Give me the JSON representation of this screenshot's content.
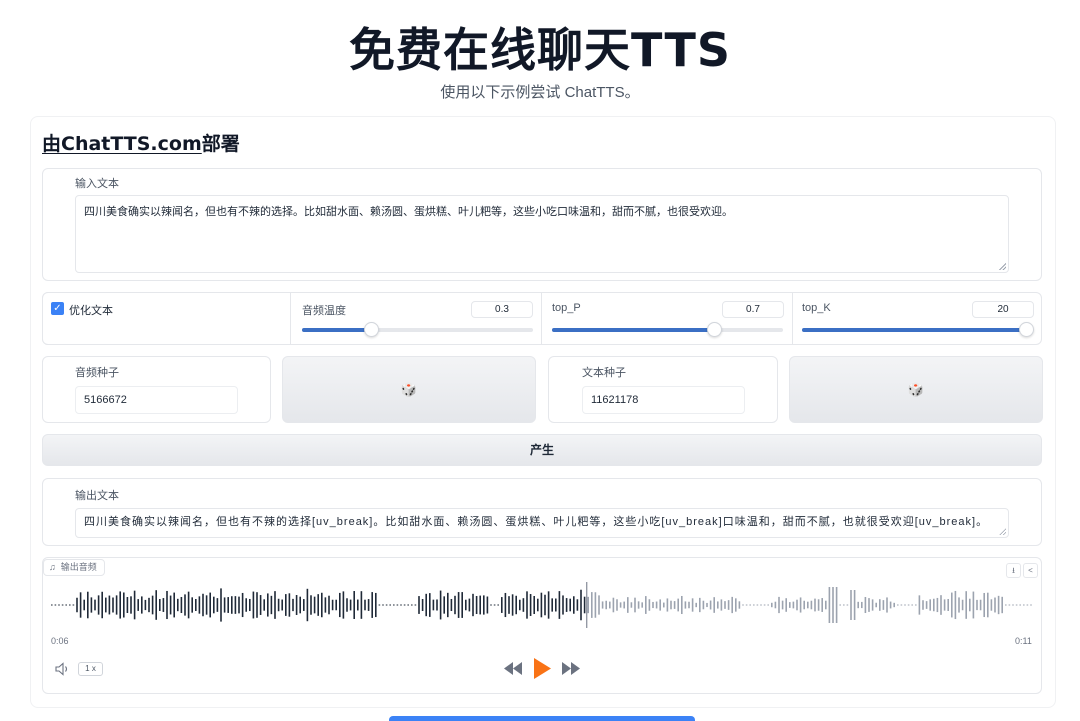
{
  "header": {
    "title": "免费在线聊天TTS",
    "subtitle": "使用以下示例尝试 ChatTTS。"
  },
  "deploy": {
    "link_text": "由ChatTTS.com",
    "suffix": "部署"
  },
  "input": {
    "label": "输入文本",
    "value": "四川美食确实以辣闻名，但也有不辣的选择。比如甜水面、赖汤圆、蛋烘糕、叶儿粑等，这些小吃口味温和，甜而不腻，也很受欢迎。"
  },
  "options": {
    "refine_label": "优化文本",
    "refine_checked": true,
    "sliders": [
      {
        "label": "音频温度",
        "value": "0.3",
        "fraction": 0.3
      },
      {
        "label": "top_P",
        "value": "0.7",
        "fraction": 0.7
      },
      {
        "label": "top_K",
        "value": "20",
        "fraction": 1.0
      }
    ]
  },
  "seeds": {
    "audio_label": "音频种子",
    "audio_value": "5166672",
    "text_label": "文本种子",
    "text_value": "11621178",
    "dice_icon": "🎲"
  },
  "generate_label": "产生",
  "output_text": {
    "label": "输出文本",
    "value": "四川美食确实以辣闻名，但也有不辣的选择[uv_break]。比如甜水面、赖汤圆、蛋烘糕、叶儿粑等，这些小吃[uv_break]口味温和，甜而不腻，也就很受欢迎[uv_break]。"
  },
  "audio": {
    "label": "输出音频",
    "current_time": "0:06",
    "duration": "0:11",
    "progress": 0.545,
    "speed": "1 x",
    "played_color": "#1f2937",
    "unplayed_color": "#9ca3af",
    "play_color": "#f97316"
  }
}
